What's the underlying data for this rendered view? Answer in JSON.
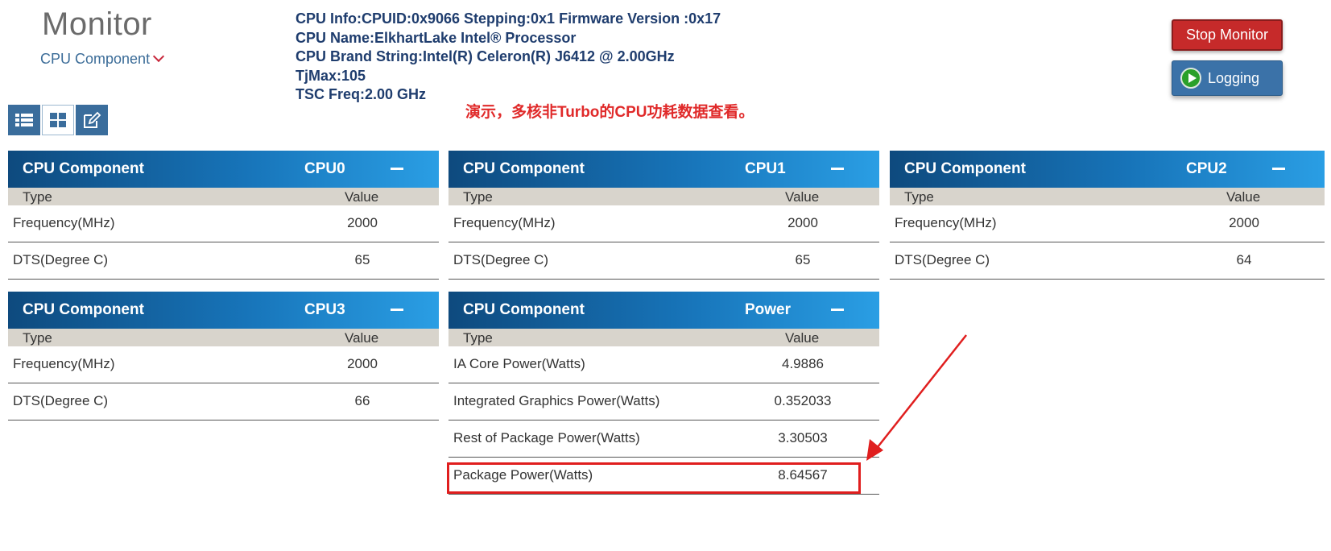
{
  "header": {
    "app_title": "Monitor",
    "component_selector": "CPU Component",
    "cpu_info": [
      "CPU Info:CPUID:0x9066 Stepping:0x1 Firmware Version :0x17",
      "CPU Name:ElkhartLake Intel® Processor",
      "CPU Brand String:Intel(R) Celeron(R) J6412 @ 2.00GHz",
      "TjMax:105",
      "TSC Freq:2.00 GHz"
    ],
    "annotation": "演示，多核非Turbo的CPU功耗数据查看。"
  },
  "buttons": {
    "stop_monitor": "Stop Monitor",
    "logging": "Logging"
  },
  "view_toggles": [
    "list-view",
    "grid-view",
    "edit-view"
  ],
  "panels": [
    {
      "title": "CPU Component",
      "name": "CPU0",
      "col_type": "Type",
      "col_value": "Value",
      "rows": [
        {
          "type": "Frequency(MHz)",
          "value": "2000"
        },
        {
          "type": "DTS(Degree C)",
          "value": "65"
        }
      ]
    },
    {
      "title": "CPU Component",
      "name": "CPU1",
      "col_type": "Type",
      "col_value": "Value",
      "rows": [
        {
          "type": "Frequency(MHz)",
          "value": "2000"
        },
        {
          "type": "DTS(Degree C)",
          "value": "65"
        }
      ]
    },
    {
      "title": "CPU Component",
      "name": "CPU2",
      "col_type": "Type",
      "col_value": "Value",
      "rows": [
        {
          "type": "Frequency(MHz)",
          "value": "2000"
        },
        {
          "type": "DTS(Degree C)",
          "value": "64"
        }
      ]
    },
    {
      "title": "CPU Component",
      "name": "CPU3",
      "col_type": "Type",
      "col_value": "Value",
      "rows": [
        {
          "type": "Frequency(MHz)",
          "value": "2000"
        },
        {
          "type": "DTS(Degree C)",
          "value": "66"
        }
      ]
    },
    {
      "title": "CPU Component",
      "name": "Power",
      "col_type": "Type",
      "col_value": "Value",
      "rows": [
        {
          "type": "IA Core Power(Watts)",
          "value": "4.9886"
        },
        {
          "type": "Integrated Graphics Power(Watts)",
          "value": "0.352033"
        },
        {
          "type": "Rest of Package Power(Watts)",
          "value": "3.30503"
        },
        {
          "type": "Package Power(Watts)",
          "value": "8.64567"
        }
      ]
    }
  ],
  "colors": {
    "header_gradient_start": "#0e4a7e",
    "header_gradient_end": "#2a9ee4",
    "stop_button": "#c62a2a",
    "logging_button": "#3b72a8",
    "annotation_red": "#e02a2a"
  }
}
